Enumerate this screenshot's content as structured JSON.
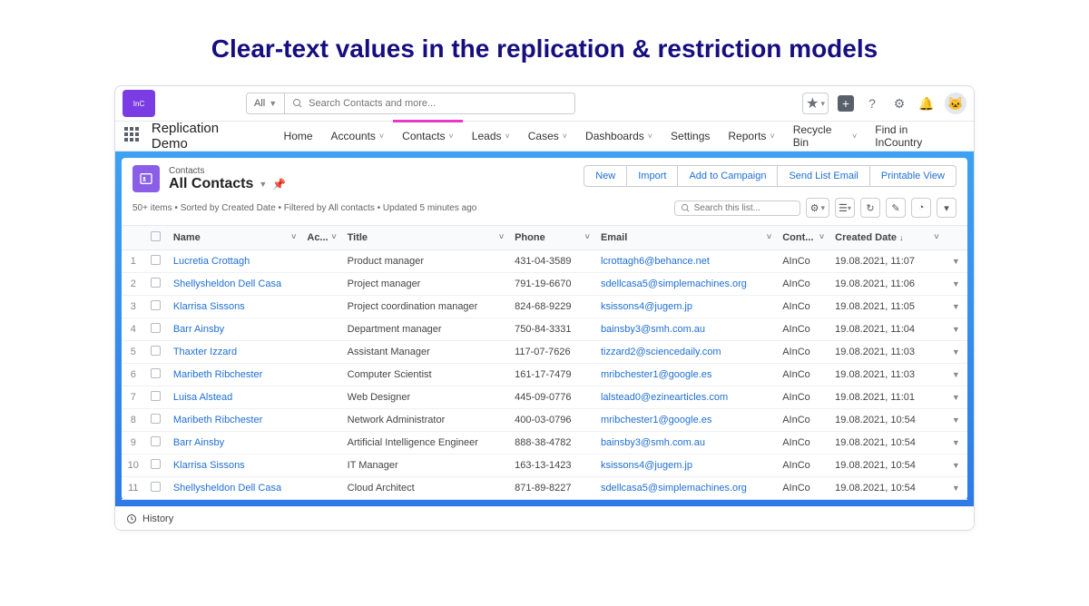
{
  "page_heading": "Clear-text values in the replication & restriction models",
  "search": {
    "scope": "All",
    "placeholder": "Search Contacts and more..."
  },
  "app_name": "Replication Demo",
  "nav": [
    {
      "label": "Home",
      "dropdown": false
    },
    {
      "label": "Accounts",
      "dropdown": true
    },
    {
      "label": "Contacts",
      "dropdown": true,
      "active": true
    },
    {
      "label": "Leads",
      "dropdown": true
    },
    {
      "label": "Cases",
      "dropdown": true
    },
    {
      "label": "Dashboards",
      "dropdown": true
    },
    {
      "label": "Settings",
      "dropdown": false
    },
    {
      "label": "Reports",
      "dropdown": true
    },
    {
      "label": "Recycle Bin",
      "dropdown": true
    },
    {
      "label": "Find in InCountry",
      "dropdown": false
    }
  ],
  "list": {
    "object": "Contacts",
    "view": "All Contacts",
    "meta": "50+ items • Sorted by Created Date • Filtered by All contacts • Updated 5 minutes ago",
    "search_placeholder": "Search this list..."
  },
  "list_actions": [
    "New",
    "Import",
    "Add to Campaign",
    "Send List Email",
    "Printable View"
  ],
  "columns": [
    "Name",
    "Ac...",
    "Title",
    "Phone",
    "Email",
    "Cont...",
    "Created Date"
  ],
  "sort_column": "Created Date",
  "rows": [
    {
      "n": 1,
      "name": "Lucretia Crottagh",
      "title": "Product manager",
      "phone": "431-04-3589",
      "email": "lcrottagh6@behance.net",
      "cont": "AInCo",
      "created": "19.08.2021, 11:07"
    },
    {
      "n": 2,
      "name": "Shellysheldon Dell Casa",
      "title": "Project manager",
      "phone": "791-19-6670",
      "email": "sdellcasa5@simplemachines.org",
      "cont": "AInCo",
      "created": "19.08.2021, 11:06"
    },
    {
      "n": 3,
      "name": "Klarrisa Sissons",
      "title": "Project coordination manager",
      "phone": "824-68-9229",
      "email": "ksissons4@jugem.jp",
      "cont": "AInCo",
      "created": "19.08.2021, 11:05"
    },
    {
      "n": 4,
      "name": "Barr Ainsby",
      "title": "Department manager",
      "phone": "750-84-3331",
      "email": "bainsby3@smh.com.au",
      "cont": "AInCo",
      "created": "19.08.2021, 11:04"
    },
    {
      "n": 5,
      "name": "Thaxter Izzard",
      "title": "Assistant Manager",
      "phone": "117-07-7626",
      "email": "tizzard2@sciencedaily.com",
      "cont": "AInCo",
      "created": "19.08.2021, 11:03"
    },
    {
      "n": 6,
      "name": "Maribeth Ribchester",
      "title": "Computer Scientist",
      "phone": "161-17-7479",
      "email": "mribchester1@google.es",
      "cont": "AInCo",
      "created": "19.08.2021, 11:03"
    },
    {
      "n": 7,
      "name": "Luisa Alstead",
      "title": "Web Designer",
      "phone": "445-09-0776",
      "email": "lalstead0@ezinearticles.com",
      "cont": "AInCo",
      "created": "19.08.2021, 11:01"
    },
    {
      "n": 8,
      "name": "Maribeth Ribchester",
      "title": "Network Administrator",
      "phone": "400-03-0796",
      "email": "mribchester1@google.es",
      "cont": "AInCo",
      "created": "19.08.2021, 10:54"
    },
    {
      "n": 9,
      "name": "Barr Ainsby",
      "title": "Artificial Intelligence Engineer",
      "phone": "888-38-4782",
      "email": "bainsby3@smh.com.au",
      "cont": "AInCo",
      "created": "19.08.2021, 10:54"
    },
    {
      "n": 10,
      "name": "Klarrisa Sissons",
      "title": "IT Manager",
      "phone": "163-13-1423",
      "email": "ksissons4@jugem.jp",
      "cont": "AInCo",
      "created": "19.08.2021, 10:54"
    },
    {
      "n": 11,
      "name": "Shellysheldon Dell Casa",
      "title": "Cloud Architect",
      "phone": "871-89-8227",
      "email": "sdellcasa5@simplemachines.org",
      "cont": "AInCo",
      "created": "19.08.2021, 10:54"
    }
  ],
  "history_label": "History"
}
